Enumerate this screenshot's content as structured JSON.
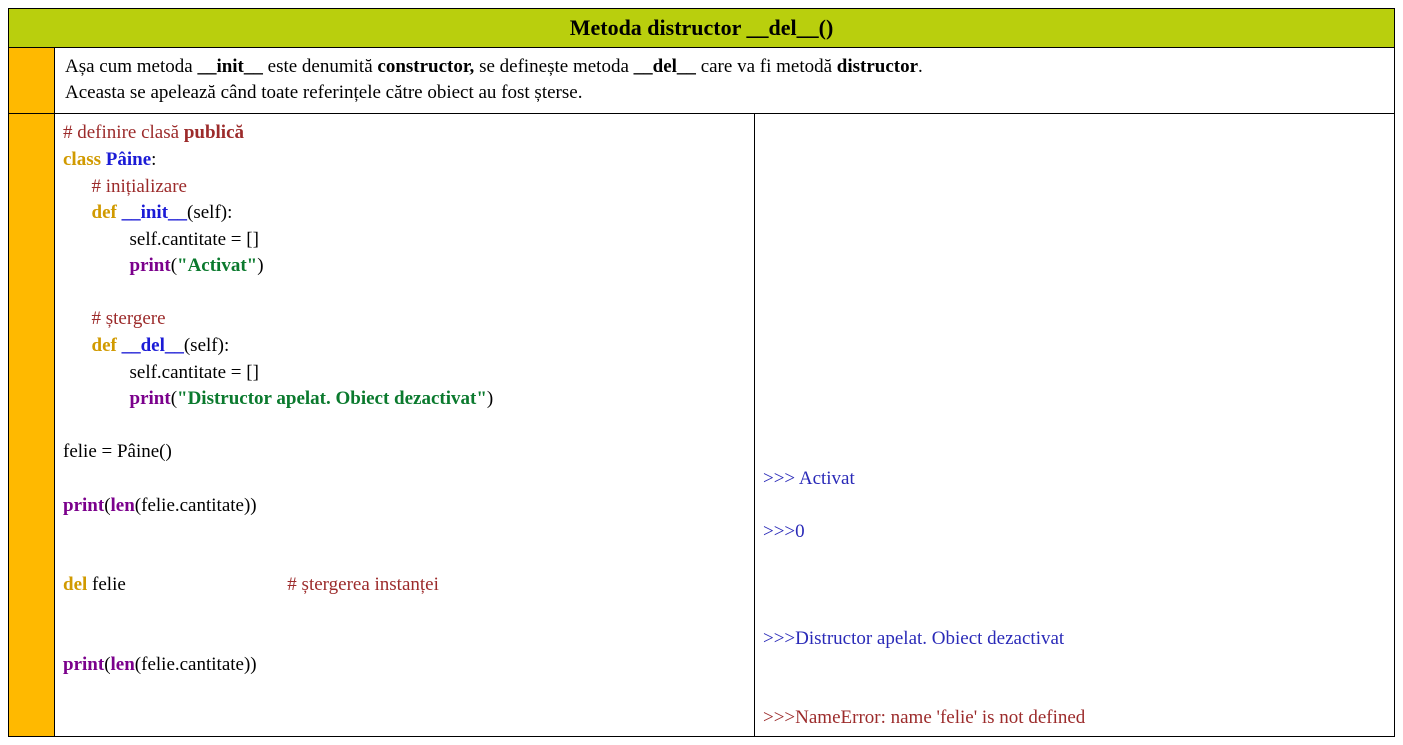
{
  "title": "Metoda distructor __del__()",
  "desc": {
    "p0": "Așa cum metoda ",
    "p1": "__init__",
    "p2": " este denumită ",
    "p3": "constructor,",
    "p4": " se definește metoda ",
    "p5": "__del__",
    "p6": " care va fi metodă ",
    "p7": "distructor",
    "p8": ".",
    "p9": "Aceasta se apelează când toate referințele către obiect au fost șterse."
  },
  "code": {
    "c01a": "# definire clasă ",
    "c01b": "publică",
    "c02a": "class",
    "c02b": " ",
    "c02c": "Pâine",
    "c02d": ":",
    "c03": "      # inițializare",
    "c04a": "      ",
    "c04b": "def",
    "c04c": " ",
    "c04d": "__init__",
    "c04e": "(self):",
    "c05": "              self.cantitate = []",
    "c06a": "              ",
    "c06b": "print",
    "c06c": "(",
    "c06d": "\"Activat\"",
    "c06e": ")",
    "c07": " ",
    "c08": "      # ștergere",
    "c09a": "      ",
    "c09b": "def",
    "c09c": " ",
    "c09d": "__del__",
    "c09e": "(self):",
    "c10": "              self.cantitate = []",
    "c11a": "              ",
    "c11b": "print",
    "c11c": "(",
    "c11d": "\"Distructor apelat. Obiect dezactivat\"",
    "c11e": ")",
    "c12": " ",
    "c13": "felie = Pâine()",
    "c14": " ",
    "c15a": "print",
    "c15b": "(",
    "c15c": "len",
    "c15d": "(felie.cantitate))",
    "c16": " ",
    "c17": " ",
    "c18a": "del",
    "c18b": " felie                                  ",
    "c18c": "# ștergerea instanței",
    "c19": " ",
    "c20": " ",
    "c21a": "print",
    "c21b": "(",
    "c21c": "len",
    "c21d": "(felie.cantitate))"
  },
  "out": {
    "blank6": "\n\n\n\n\n\n\n\n\n\n\n\n",
    "o1": ">>> Activat",
    "blank1a": " ",
    "o2": ">>>0",
    "blank2a": " ",
    "blank2b": " ",
    "blank2c": " ",
    "o3": ">>>Distructor apelat. Obiect dezactivat",
    "blank3a": " ",
    "blank3b": " ",
    "o4": ">>>NameError: name 'felie' is not defined"
  }
}
